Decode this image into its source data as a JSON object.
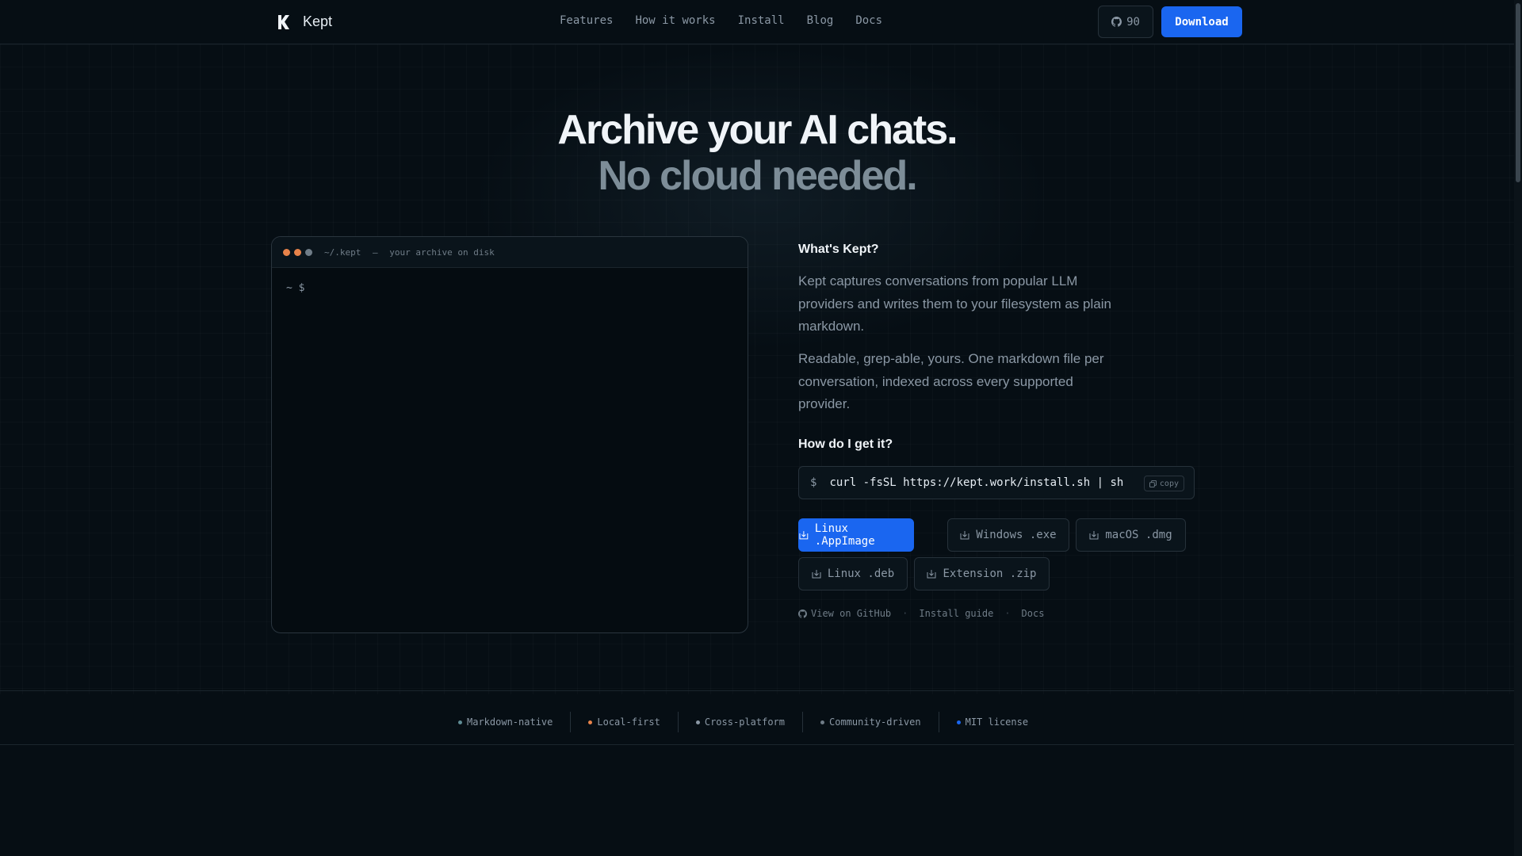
{
  "nav": {
    "brand": "Kept",
    "links": [
      "Features",
      "How it works",
      "Install",
      "Blog",
      "Docs"
    ],
    "github_count": "90",
    "download_label": "Download"
  },
  "hero": {
    "title": "Archive your AI chats.",
    "subtitle": "No cloud needed."
  },
  "terminal": {
    "path": "~/.kept",
    "dash": "—",
    "caption": "your archive on disk",
    "prompt": "~ $",
    "dot_colors": [
      "#e8834a",
      "#e8834a",
      "#6f7c87"
    ]
  },
  "about": {
    "heading": "What's Kept?",
    "para1": "Kept captures conversations from popular LLM providers and writes them to your filesystem as plain markdown.",
    "para2": "Readable, grep-able, yours. One markdown file per conversation, indexed across every supported provider."
  },
  "install": {
    "heading": "How do I get it?",
    "dollar": "$",
    "command": "curl -fsSL https://kept.work/install.sh | sh",
    "copy_label": "copy",
    "downloads": [
      {
        "label": "Linux .AppImage",
        "primary": true
      },
      {
        "label": "Windows .exe",
        "primary": false
      },
      {
        "label": "macOS .dmg",
        "primary": false
      },
      {
        "label": "Linux .deb",
        "primary": false
      },
      {
        "label": "Extension .zip",
        "primary": false
      }
    ],
    "links": [
      "View on GitHub",
      "Install guide",
      "Docs"
    ],
    "separator": "·"
  },
  "features": [
    {
      "label": "Markdown-native",
      "color": "#5f8c95"
    },
    {
      "label": "Local-first",
      "color": "#e8834a"
    },
    {
      "label": "Cross-platform",
      "color": "#8b98a5"
    },
    {
      "label": "Community-driven",
      "color": "#6f7c87"
    },
    {
      "label": "MIT license",
      "color": "#1a66f0"
    }
  ],
  "colors": {
    "accent": "#1a66f0",
    "background": "#060e14"
  }
}
